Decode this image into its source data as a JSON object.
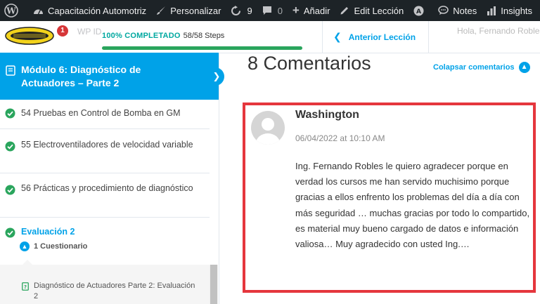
{
  "admin_bar": {
    "site_name": "Capacitación Automotriz",
    "customize": "Personalizar",
    "updates_count": "9",
    "comments_count": "0",
    "add_new": "Añadir",
    "edit_lesson": "Edit Lección",
    "notes": "Notes",
    "insights": "Insights"
  },
  "header": {
    "notification_count": "1",
    "ghost_text": "WP ID",
    "progress_label": "100% COMPLETADO",
    "progress_steps": "58/58 Steps",
    "progress_percent": 100,
    "prev_lesson": "Anterior Lección",
    "greeting": "Hola, Fernando Robles"
  },
  "sidebar": {
    "module_title": "Módulo 6: Diagnóstico de Actuadores – Parte 2",
    "lessons": [
      {
        "label": "54 Pruebas en Control de Bomba en GM",
        "completed": true
      },
      {
        "label": "55 Electroventiladores de velocidad variable",
        "completed": true
      },
      {
        "label": "56 Prácticas y procedimiento de diagnóstico",
        "completed": true
      }
    ],
    "evaluation": {
      "title": "Evaluación 2",
      "quiz_count": "1 Cuestionario",
      "quiz_item": "Diagnóstico de Actuadores Parte 2: Evaluación 2"
    }
  },
  "main": {
    "comments_title": "8 Comentarios",
    "collapse_label": "Colapsar comentarios",
    "comment": {
      "author": "Washington",
      "date": "06/04/2022 at 10:10 AM",
      "body": "Ing. Fernando Robles le quiero agradecer porque en verdad los cursos me han servido muchisimo porque gracias a ellos enfrento los problemas del día a día con más seguridad … muchas gracias por todo lo compartido, es material muy bueno cargado de datos e información valiosa… Muy agradecido con usted Ing.…"
    }
  },
  "colors": {
    "accent": "#00a2e8",
    "success": "#2aa55d",
    "highlight_border": "#e5363d",
    "admin_bar": "#1d2327"
  }
}
